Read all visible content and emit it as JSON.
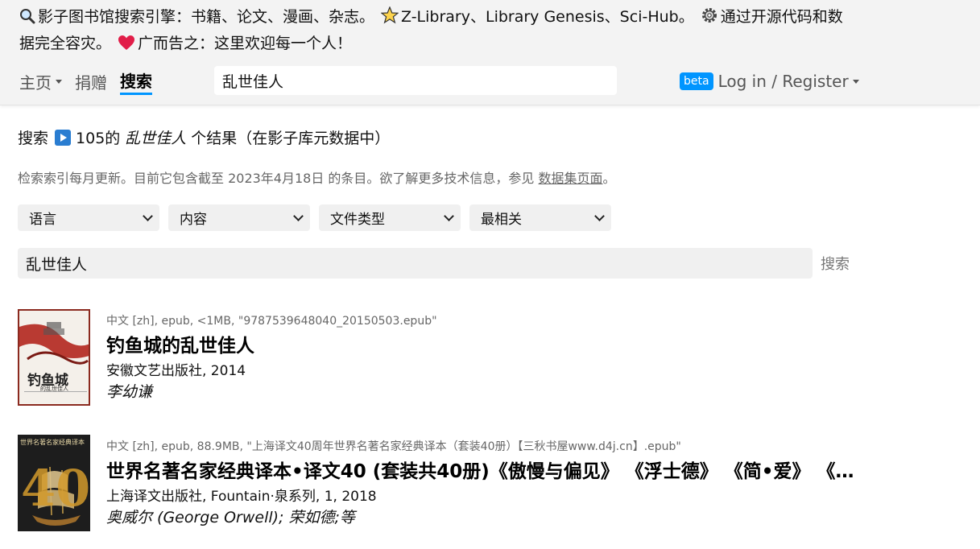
{
  "banner": {
    "part1": "影子图书馆搜索引擎：书籍、论文、漫画、杂志。",
    "part2": "Z-Library、Library Genesis、Sci-Hub。",
    "part3": "通过开源代码和数据完全容灾。",
    "part4": "广而告之：这里欢迎每一个人！",
    "icons": [
      "magnifier-icon",
      "star-icon",
      "gear-icon",
      "heart-icon"
    ]
  },
  "nav": {
    "home": "主页",
    "donate": "捐赠",
    "search": "搜索"
  },
  "top_search": {
    "value": "乱世佳人"
  },
  "account": {
    "beta": "beta",
    "login": "Log in / Register"
  },
  "results_header": {
    "prefix": "搜索",
    "count": "105的",
    "query": "乱世佳人",
    "suffix": "个结果（在影子库元数据中）"
  },
  "index_info": {
    "text": "检索索引每月更新。目前它包含截至 2023年4月18日 的条目。欲了解更多技术信息，参见",
    "link": "数据集页面",
    "end": "。"
  },
  "filters": [
    {
      "label": "语言"
    },
    {
      "label": "内容"
    },
    {
      "label": "文件类型"
    },
    {
      "label": "最相关"
    }
  ],
  "main_search": {
    "value": "乱世佳人",
    "button": "搜索"
  },
  "results": [
    {
      "meta": "中文 [zh], epub, <1MB, \"9787539648040_20150503.epub\"",
      "title": "钓鱼城的乱世佳人",
      "publisher": "安徽文艺出版社, 2014",
      "author": "李幼谦",
      "cover_title": "钓鱼城",
      "cover_sub": "的乱世佳人"
    },
    {
      "meta": "中文 [zh], epub, 88.9MB, \"上海译文40周年世界名著名家经典译本（套装40册）【三秋书屋www.d4j.cn】.epub\"",
      "title": "世界名著名家经典译本•译文40 (套装共40册)《傲慢与偏见》 《浮士德》 《简•爱》 《呼啸山庄》",
      "publisher": "上海译文出版社, Fountain·泉系列, 1, 2018",
      "author": "奥威尔 (George Orwell); 荣如德;等",
      "cover_title": "世界名著名家经典译本",
      "cover_num": "40"
    }
  ],
  "colors": {
    "accent": "#0095ff",
    "header_bg": "#f3f3f3"
  }
}
